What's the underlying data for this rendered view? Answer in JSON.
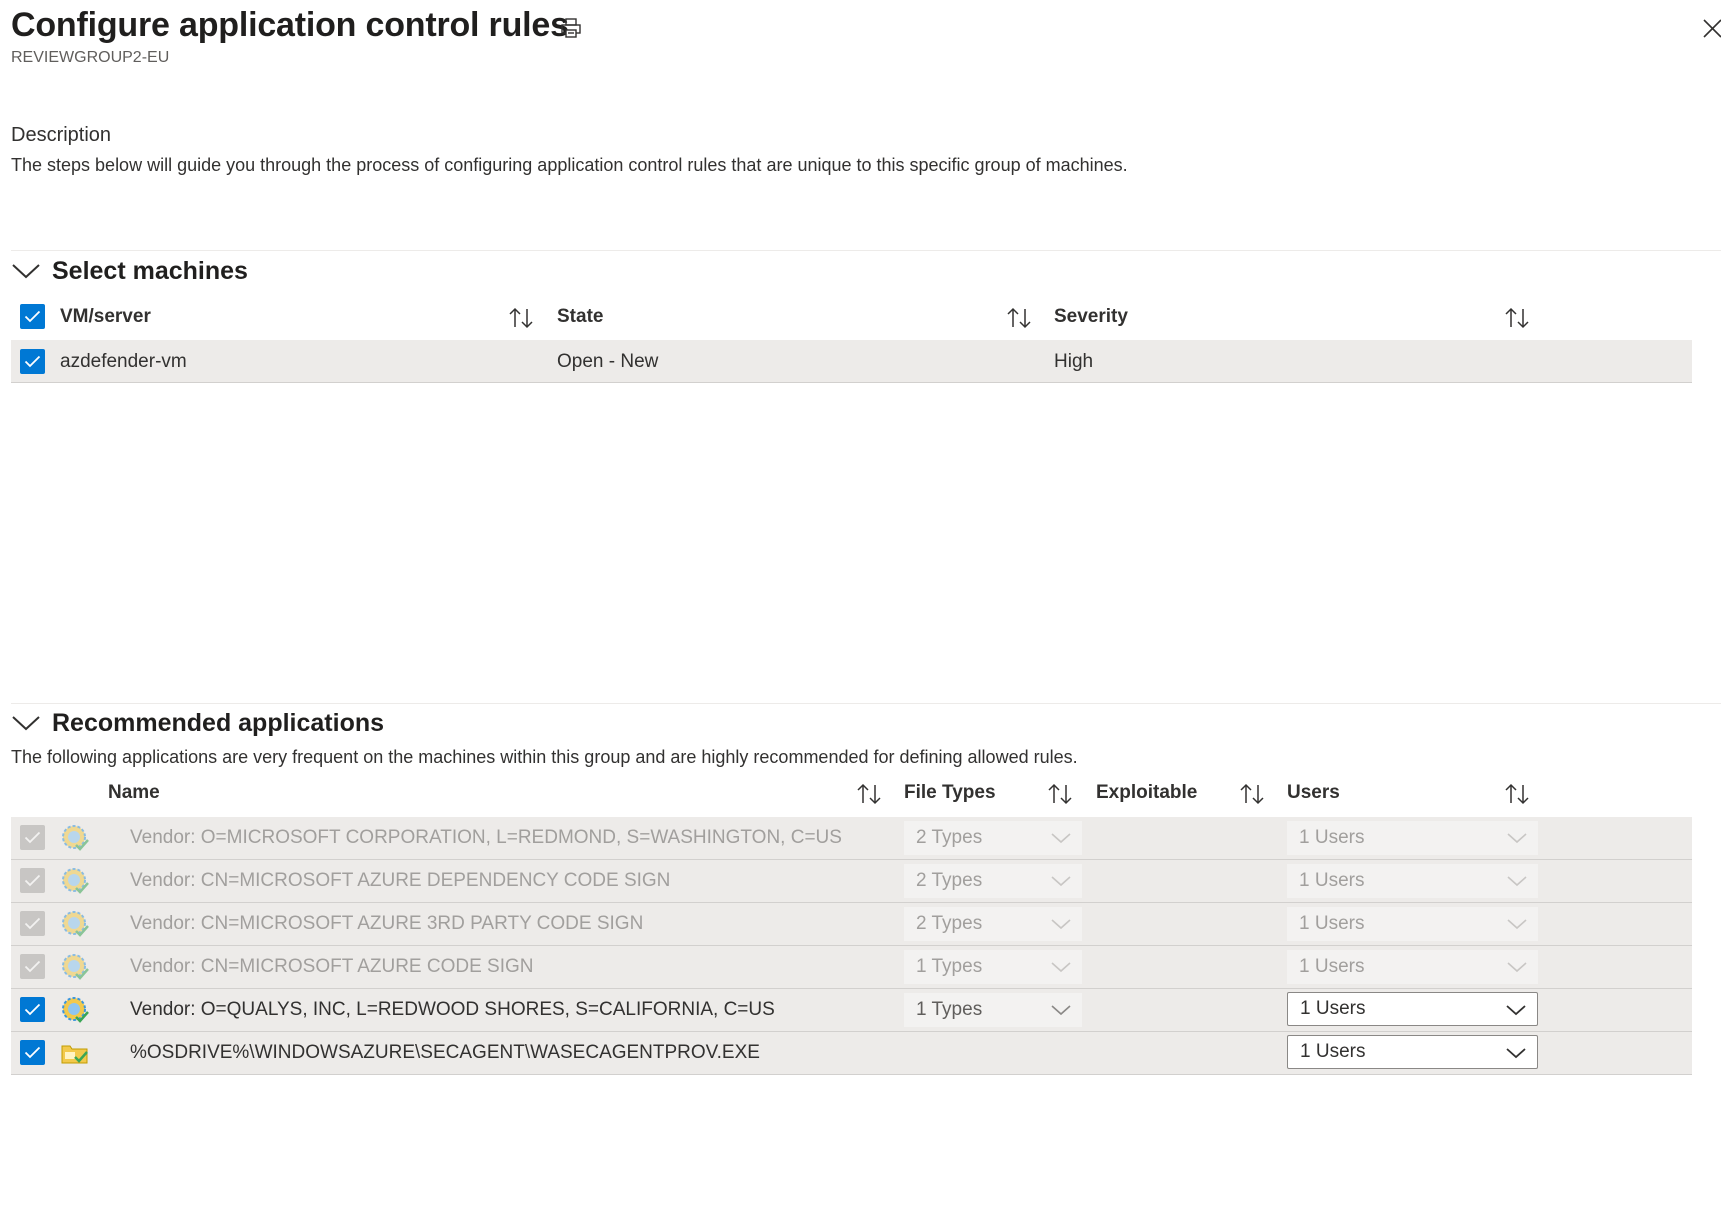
{
  "header": {
    "title": "Configure application control rules",
    "subtitle": "REVIEWGROUP2-EU"
  },
  "description": {
    "label": "Description",
    "text": "The steps below will guide you through the process of configuring application control rules that are unique to this specific group of machines."
  },
  "select_machines": {
    "title": "Select machines",
    "columns": [
      "VM/server",
      "State",
      "Severity"
    ],
    "rows": [
      {
        "vm": "azdefender-vm",
        "state": "Open - New",
        "severity": "High",
        "checked": true
      }
    ]
  },
  "recommended": {
    "title": "Recommended applications",
    "intro": "The following applications are very frequent on the machines within this group and are highly recommended for defining allowed rules.",
    "columns": [
      "Name",
      "File Types",
      "Exploitable",
      "Users"
    ],
    "rows": [
      {
        "name": "Vendor: O=MICROSOFT CORPORATION, L=REDMOND, S=WASHINGTON, C=US",
        "file_types": "2 Types",
        "users": "1 Users",
        "icon": "certificate-icon",
        "enabled": false
      },
      {
        "name": "Vendor: CN=MICROSOFT AZURE DEPENDENCY CODE SIGN",
        "file_types": "2 Types",
        "users": "1 Users",
        "icon": "certificate-icon",
        "enabled": false
      },
      {
        "name": "Vendor: CN=MICROSOFT AZURE 3RD PARTY CODE SIGN",
        "file_types": "2 Types",
        "users": "1 Users",
        "icon": "certificate-icon",
        "enabled": false
      },
      {
        "name": "Vendor: CN=MICROSOFT AZURE CODE SIGN",
        "file_types": "1 Types",
        "users": "1 Users",
        "icon": "certificate-icon",
        "enabled": false
      },
      {
        "name": "Vendor: O=QUALYS, INC, L=REDWOOD SHORES, S=CALIFORNIA, C=US",
        "file_types": "1 Types",
        "users": "1 Users",
        "icon": "certificate-icon",
        "enabled": true
      },
      {
        "name": "%OSDRIVE%\\WINDOWSAZURE\\SECAGENT\\WASECAGENTPROV.EXE",
        "file_types": "",
        "users": "1 Users",
        "icon": "file-path-icon",
        "enabled": true
      }
    ]
  },
  "colors": {
    "accent": "#0078d4",
    "row_bg": "#edebe9",
    "disabled_text": "#a19f9d"
  }
}
